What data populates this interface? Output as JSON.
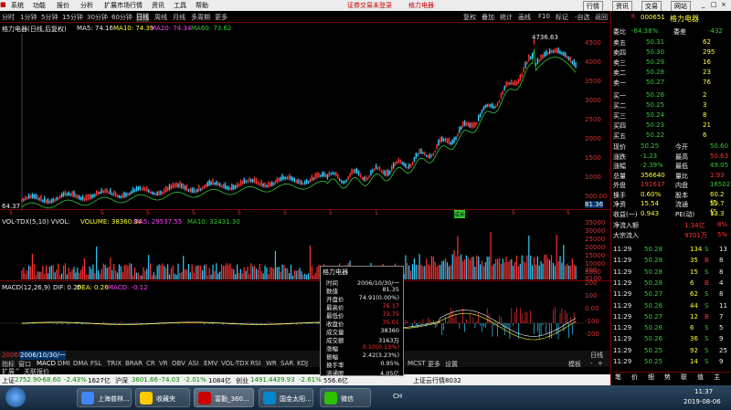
{
  "menubar": {
    "items": [
      "系统",
      "功能",
      "报价",
      "分析",
      "扩展市场行情",
      "资讯",
      "工具",
      "帮助"
    ],
    "notice": "证券交易未登录",
    "stock_name": "格力电器",
    "right_btns": [
      "行情",
      "资讯",
      "交易",
      "网站"
    ]
  },
  "tbar": {
    "tabs": [
      "分时",
      "1分钟",
      "5分钟",
      "15分钟",
      "30分钟",
      "60分钟",
      "日线",
      "周线",
      "月线",
      "多周期",
      "更多"
    ],
    "right": [
      "复权",
      "叠加",
      "统计",
      "画线",
      "F10",
      "标记",
      "-自选",
      "返回"
    ]
  },
  "info": {
    "name": "格力电器(日线,后复权)",
    "ma5": "MA5: 74.16",
    "ma10": "MA10: 74.39",
    "ma20": "MA20: 74.34",
    "ma60": "MA60: 73.62"
  },
  "main_axis": [
    "4500",
    "4000",
    "3500",
    "3000",
    "2500",
    "2000",
    "1500",
    "1000",
    "500.00"
  ],
  "main_labels": {
    "peak": "4736.63",
    "low": "64.37",
    "last": "81.36",
    "axis_bottom": "81.36",
    "x_labels": [
      "5",
      "5",
      "5",
      "5",
      "5",
      "5",
      "5",
      "1",
      "5",
      "5",
      "5"
    ],
    "tag": "成长"
  },
  "vol": {
    "label": "VOL-TDX(5,10) VVOL: ",
    "volume": "VOLUME: 38360.34",
    "ma5": "MA5: 29537.55",
    "ma10": "MA10: 32431.30",
    "axis": [
      "35000",
      "30000",
      "25000",
      "20000",
      "15000",
      "10000",
      "5000",
      "X100"
    ]
  },
  "macd": {
    "label": "MACD(12,26,9)",
    "dif": "DIF: 0.26",
    "dea": "DEA: 0.26",
    "macd": "MACD: -0.12",
    "axis": [
      "300",
      "200",
      "100",
      "0.00",
      "-100",
      "-200"
    ]
  },
  "bottom": {
    "date_prefix": "2006年",
    "date": "2006/10/30/一",
    "tabs": [
      "指标",
      "窗口",
      "MACD",
      "DMI",
      "DMA",
      "FSL",
      "TRIX",
      "BRAR",
      "CR",
      "VR",
      "OBV",
      "ASI",
      "EMV",
      "VOL-TDX",
      "RSI",
      "WR",
      "SAR",
      "KDJ"
    ],
    "extra": [
      "MCST",
      "更多",
      "设置",
      "模板",
      "-",
      "+",
      "-"
    ],
    "row2": [
      "扩展^",
      "关联报价"
    ],
    "rixian": "日线"
  },
  "popup": {
    "title": "格力电器",
    "rows": [
      [
        "时间",
        "2006/10/30/一"
      ],
      [
        "数值",
        "81.35"
      ],
      [
        "开盘价",
        "74.91(0.00%)"
      ],
      [
        "最高价",
        "76.17"
      ],
      [
        "最低价",
        "73.75"
      ],
      [
        "收盘价",
        "75.01"
      ],
      [
        "成交量",
        "38360"
      ],
      [
        "成交额",
        "3163万"
      ],
      [
        "涨幅",
        "0.10(0.13%)"
      ],
      [
        "振幅",
        "2.42(3.23%)"
      ],
      [
        "换手率",
        "0.95%"
      ],
      [
        "流通股",
        "4.05亿"
      ]
    ]
  },
  "statusbar": {
    "sh_label": "上证",
    "sh": "2752.90",
    "sh_chg": "-68.60",
    "sh_pct": "-2.43%",
    "sh_amt": "1627亿",
    "sz_label": "沪深",
    "sz": "3601.66",
    "sz_chg": "-74.03",
    "sz_pct": "-2.01%",
    "sz_amt": "1084亿",
    "cy_label": "创业",
    "cy": "1491.44",
    "cy_chg": "-39.93",
    "cy_pct": "-2.61%",
    "cy_amt": "556.6亿",
    "right": "上证云行情8032"
  },
  "rp": {
    "code": "000651",
    "name": "格力电器",
    "wb_label": "委比",
    "wb": "-84.38%",
    "wc_label": "委差",
    "wc": "-432",
    "sells": [
      [
        "卖五",
        "50.31",
        "62"
      ],
      [
        "卖四",
        "50.30",
        "295"
      ],
      [
        "卖三",
        "50.29",
        "16"
      ],
      [
        "卖二",
        "50.28",
        "23"
      ],
      [
        "卖一",
        "50.27",
        "76"
      ]
    ],
    "buys": [
      [
        "买一",
        "50.26",
        "2"
      ],
      [
        "买二",
        "50.25",
        "3"
      ],
      [
        "买三",
        "50.24",
        "8"
      ],
      [
        "买四",
        "50.23",
        "21"
      ],
      [
        "买五",
        "50.22",
        "6"
      ]
    ],
    "stats": [
      [
        "现价",
        "50.25",
        "今开",
        "50.60"
      ],
      [
        "涨跌",
        "-1.23",
        "最高",
        "50.63"
      ],
      [
        "涨幅",
        "-2.39%",
        "最低",
        "49.05"
      ],
      [
        "总量",
        "356640",
        "量比",
        "1.93"
      ],
      [
        "外盘",
        "191617",
        "内盘",
        "165022"
      ],
      [
        "换手",
        "0.60%",
        "股本",
        "60.2亿"
      ],
      [
        "净资",
        "15.54",
        "流通",
        "59.7亿"
      ],
      [
        "收益(一)",
        "0.943",
        "PE(动)",
        "13.3"
      ]
    ],
    "flow": [
      [
        "净流入额",
        "1.34亿",
        "8%"
      ],
      [
        "大宗流入",
        "9701万",
        "5%"
      ]
    ],
    "ticks": [
      [
        "11:29",
        "50.28",
        "134",
        "S",
        "13"
      ],
      [
        "11:29",
        "50.28",
        "35",
        "B",
        "8"
      ],
      [
        "11:29",
        "50.28",
        "15",
        "S",
        "8"
      ],
      [
        "11:29",
        "50.28",
        "6",
        "B",
        "4"
      ],
      [
        "11:29",
        "50.27",
        "62",
        "S",
        "8"
      ],
      [
        "11:29",
        "50.26",
        "44",
        "S",
        "11"
      ],
      [
        "11:29",
        "50.27",
        "12",
        "B",
        "7"
      ],
      [
        "11:29",
        "50.26",
        "6",
        "S",
        "5"
      ],
      [
        "11:29",
        "50.26",
        "36",
        "S",
        "9"
      ],
      [
        "11:29",
        "50.25",
        "92",
        "S",
        "25"
      ],
      [
        "11:29",
        "50.25",
        "14",
        "S",
        "9"
      ]
    ],
    "tabs": [
      "笔",
      "价",
      "细",
      "势",
      "联",
      "值",
      "主"
    ]
  },
  "taskbar": {
    "items": [
      "上海普林...",
      "收藏夹",
      "富勤_360...",
      "国金太阳...",
      "微信"
    ],
    "ch": "CH",
    "time": "11:37",
    "date": "2019-08-06"
  }
}
